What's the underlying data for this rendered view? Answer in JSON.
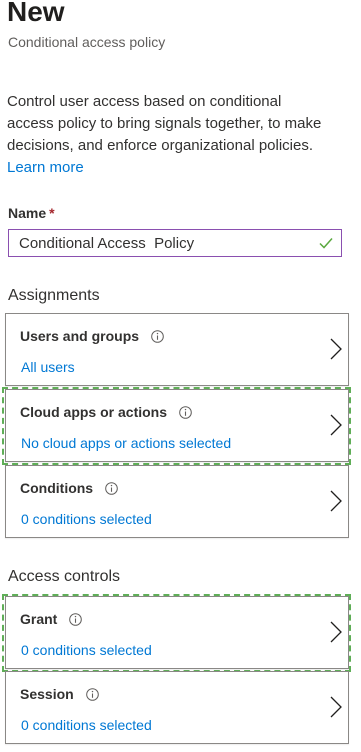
{
  "header": {
    "title": "New",
    "subtitle": "Conditional access policy"
  },
  "description": {
    "text": "Control user access based on conditional access policy to bring signals together, to make decisions, and enforce organizational policies.",
    "link": "Learn more"
  },
  "name_field": {
    "label": "Name",
    "required_marker": "*",
    "value": "Conditional Access  Policy",
    "status_icon": "check-icon"
  },
  "assignments": {
    "heading": "Assignments",
    "cards": [
      {
        "title": "Users and groups",
        "value": "All users",
        "highlighted": false
      },
      {
        "title": "Cloud apps or actions",
        "value": "No cloud apps or actions selected",
        "highlighted": true
      },
      {
        "title": "Conditions",
        "value": "0 conditions selected",
        "highlighted": false
      }
    ]
  },
  "access_controls": {
    "heading": "Access controls",
    "cards": [
      {
        "title": "Grant",
        "value": "0 conditions selected",
        "highlighted": true
      },
      {
        "title": "Session",
        "value": "0 conditions selected",
        "highlighted": false
      }
    ]
  },
  "colors": {
    "link": "#0078d4",
    "input_border": "#8a4fb0",
    "check": "#5aa83f",
    "highlight_dashes": "#5fae57",
    "required": "#a4262c"
  }
}
